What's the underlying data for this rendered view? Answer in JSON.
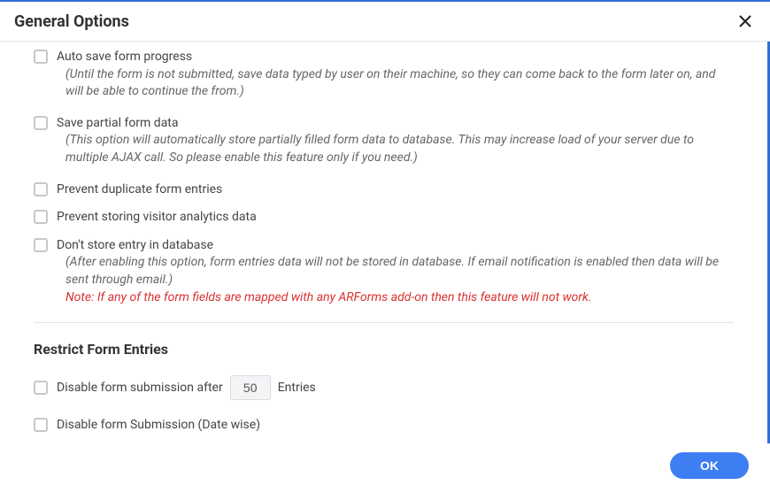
{
  "dialog": {
    "title": "General Options",
    "ok_label": "OK"
  },
  "options": {
    "auto_save": {
      "label": "Auto save form progress",
      "desc": "(Until the form is not submitted, save data typed by user on their machine, so they can come back to the form later on, and will be able to continue the from.)"
    },
    "save_partial": {
      "label": "Save partial form data",
      "desc": "(This option will automatically store partially filled form data to database. This may increase load of your server due to multiple AJAX call. So please enable this feature only if you need.)"
    },
    "prevent_duplicate": {
      "label": "Prevent duplicate form entries"
    },
    "prevent_analytics": {
      "label": "Prevent storing visitor analytics data"
    },
    "no_store": {
      "label": "Don't store entry in database",
      "desc": "(After enabling this option, form entries data will not be stored in database. If email notification is enabled then data will be sent through email.)",
      "note": "Note: If any of the form fields are mapped with any ARForms add-on then this feature will not work."
    }
  },
  "restrict": {
    "title": "Restrict Form Entries",
    "disable_after": {
      "label_before": "Disable form submission after",
      "value": "50",
      "label_after": "Entries"
    },
    "disable_date": {
      "label": "Disable form Submission (Date wise)"
    }
  }
}
